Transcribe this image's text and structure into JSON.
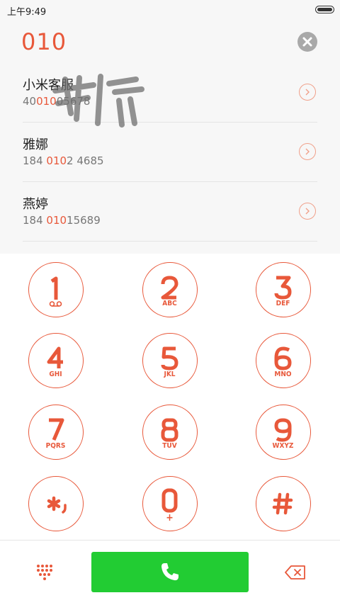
{
  "status_bar": {
    "time": "上午9:49"
  },
  "dialer": {
    "input": "010"
  },
  "results": [
    {
      "name": "小米客服",
      "phone_before": "40",
      "phone_match": "010",
      "phone_after": "05678"
    },
    {
      "name": "雅娜",
      "phone_before": "184 ",
      "phone_match": "010",
      "phone_after": "2 4685"
    },
    {
      "name": "燕婷",
      "phone_before": "184 ",
      "phone_match": "010",
      "phone_after": "15689"
    }
  ],
  "keypad": {
    "keys": [
      {
        "digit": "1",
        "letters": ""
      },
      {
        "digit": "2",
        "letters": "ABC"
      },
      {
        "digit": "3",
        "letters": "DEF"
      },
      {
        "digit": "4",
        "letters": "GHI"
      },
      {
        "digit": "5",
        "letters": "JKL"
      },
      {
        "digit": "6",
        "letters": "MNO"
      },
      {
        "digit": "7",
        "letters": "PQRS"
      },
      {
        "digit": "8",
        "letters": "TUV"
      },
      {
        "digit": "9",
        "letters": "WXYZ"
      },
      {
        "digit": "*,",
        "letters": ""
      },
      {
        "digit": "0",
        "letters": "+"
      },
      {
        "digit": "#",
        "letters": ""
      }
    ]
  },
  "colors": {
    "accent": "#e8583a",
    "call_green": "#22cc33",
    "clear_grey": "#a9a9a9"
  },
  "icons": {
    "clear": "close-icon",
    "detail": "chevron-right-icon",
    "call": "phone-icon",
    "dialpad": "dialpad-grid-icon",
    "backspace": "backspace-icon",
    "voicemail": "voicemail-icon",
    "battery": "battery-icon"
  }
}
